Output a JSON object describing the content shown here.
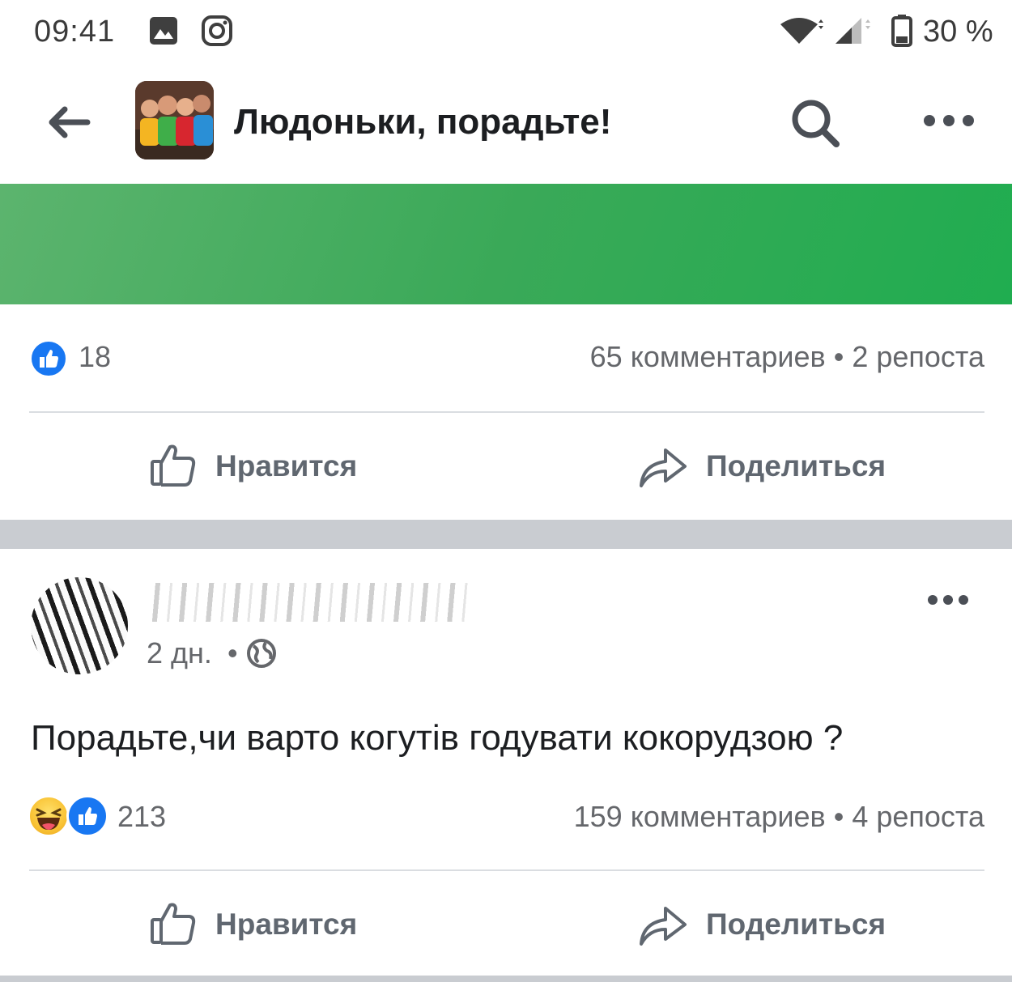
{
  "status_bar": {
    "time": "09:41",
    "battery": "30 %",
    "icons": [
      "gallery-icon",
      "instagram-icon",
      "wifi-icon",
      "signal-icon",
      "battery-icon"
    ]
  },
  "header": {
    "title": "Людоньки, порадьте!",
    "icons": [
      "back-arrow-icon",
      "search-icon",
      "more-icon"
    ]
  },
  "banner": {
    "color": "#2eab55"
  },
  "post1": {
    "reactions_count": "18",
    "comments": "65 комментариев",
    "reposts": "2 репоста",
    "like_label": "Нравится",
    "share_label": "Поделиться"
  },
  "post2": {
    "time": "2 дн.",
    "text": "Порадьте,чи варто когутів годувати кокорудзою ?",
    "reactions_count": "213",
    "comments": "159 комментариев",
    "reposts": "4 репоста",
    "like_label": "Нравится",
    "share_label": "Поделиться"
  },
  "colors": {
    "accent": "#1877f2",
    "text": "#1c1e21",
    "muted": "#65676b",
    "separator": "#c9ccd1"
  },
  "separator_dot": "•"
}
